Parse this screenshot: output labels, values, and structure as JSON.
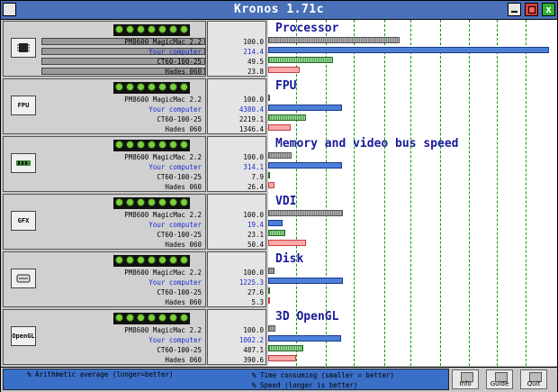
{
  "window": {
    "title": "Kronos 1.71c",
    "close_glyph": "x"
  },
  "sections": [
    {
      "title": "Processor",
      "icon": "cpu-icon",
      "icon_label": "",
      "rows": [
        {
          "name": "PM8600 MagicMac 2.2",
          "value": "100.0",
          "bar": 100.0
        },
        {
          "name": "Your computer",
          "value": "214.4",
          "bar": 214.4
        },
        {
          "name": "CT60-100-25",
          "value": "49.5",
          "bar": 49.5
        },
        {
          "name": "Hades 060",
          "value": "23.8",
          "bar": 23.8
        }
      ]
    },
    {
      "title": "FPU",
      "icon": "fpu-icon",
      "icon_label": "FPU",
      "rows": [
        {
          "name": "PM8600 MagicMac 2.2",
          "value": "100.0",
          "bar": 100.0
        },
        {
          "name": "Your computer",
          "value": "4380.4",
          "bar": 4380.4
        },
        {
          "name": "CT60-100-25",
          "value": "2219.1",
          "bar": 2219.1
        },
        {
          "name": "Hades 060",
          "value": "1346.4",
          "bar": 1346.4
        }
      ]
    },
    {
      "title": "Memory and video bus speed",
      "icon": "memory-icon",
      "icon_label": "",
      "rows": [
        {
          "name": "PM8600 MagicMac 2.2",
          "value": "100.0",
          "bar": 100.0
        },
        {
          "name": "Your computer",
          "value": "314.1",
          "bar": 314.1
        },
        {
          "name": "CT60-100-25",
          "value": "7.9",
          "bar": 7.9
        },
        {
          "name": "Hades 060",
          "value": "26.4",
          "bar": 26.4
        }
      ]
    },
    {
      "title": "VDI",
      "icon": "gfx-icon",
      "icon_label": "GFX",
      "rows": [
        {
          "name": "PM8600 MagicMac 2.2",
          "value": "100.0",
          "bar": 100.0
        },
        {
          "name": "Your computer",
          "value": "19.4",
          "bar": 19.4
        },
        {
          "name": "CT60-100-25",
          "value": "23.1",
          "bar": 23.1
        },
        {
          "name": "Hades 060",
          "value": "50.4",
          "bar": 50.4
        }
      ]
    },
    {
      "title": "Disk",
      "icon": "disk-icon",
      "icon_label": "",
      "rows": [
        {
          "name": "PM8600 MagicMac 2.2",
          "value": "100.0",
          "bar": 100.0
        },
        {
          "name": "Your computer",
          "value": "1225.3",
          "bar": 1225.3
        },
        {
          "name": "CT60-100-25",
          "value": "27.6",
          "bar": 27.6
        },
        {
          "name": "Hades 060",
          "value": "5.3",
          "bar": 5.3
        }
      ]
    },
    {
      "title": "3D OpenGL",
      "icon": "opengl-icon",
      "icon_label": "OpenGL",
      "rows": [
        {
          "name": "PM8600 MagicMac 2.2",
          "value": "100.0",
          "bar": 100.0
        },
        {
          "name": "Your computer",
          "value": "1002.2",
          "bar": 1002.2
        },
        {
          "name": "CT60-100-25",
          "value": "487.1",
          "bar": 487.1
        },
        {
          "name": "Hades 060",
          "value": "390.6",
          "bar": 390.6
        }
      ]
    }
  ],
  "footer": {
    "arith_label": "% Arithmetic average (longer=better)",
    "time_label": "% Time consuming (smaller = better)",
    "speed_label": "% Speed (longer is better)",
    "buttons": [
      {
        "label": "Info",
        "icon": "info-icon"
      },
      {
        "label": "Guide",
        "icon": "guide-icon"
      },
      {
        "label": "Quit",
        "icon": "quit-icon"
      }
    ]
  },
  "colors": {
    "title_bar": "#4a70b8",
    "your_computer": "#1a2bd0",
    "section_title": "#1a1a9a",
    "grid": "#00a000"
  }
}
